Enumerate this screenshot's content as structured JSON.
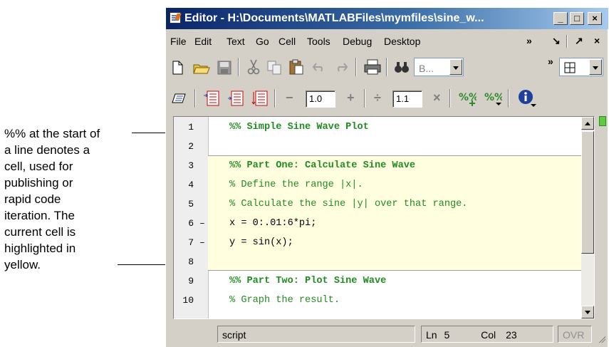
{
  "annotation": {
    "lines": [
      "%% at the start of",
      "a line denotes a",
      "cell, used for",
      "publishing or",
      "rapid code",
      "iteration. The",
      "current cell is",
      "highlighted in",
      "yellow."
    ]
  },
  "window": {
    "title": "Editor - H:\\Documents\\MATLABFiles\\mymfiles\\sine_w...",
    "controls": {
      "minimize": "_",
      "maximize": "□",
      "close": "×"
    }
  },
  "menubar": {
    "items": [
      "File",
      "Edit",
      "Text",
      "Go",
      "Cell",
      "Tools",
      "Debug",
      "Desktop"
    ],
    "overflow": "»",
    "dock": "↘",
    "undock": "↗",
    "close": "×"
  },
  "toolbar1": {
    "icons": [
      "new-file-icon",
      "open-folder-icon",
      "save-icon",
      "cut-icon",
      "copy-icon",
      "paste-icon",
      "undo-icon",
      "redo-icon",
      "print-icon",
      "find-icon"
    ],
    "stack_combo": "B...",
    "overflow": "»",
    "layout_icon": "tile-layout-icon"
  },
  "toolbar2": {
    "decrement": "−",
    "increment_value": "1.0",
    "increment": "+",
    "divide": "÷",
    "multiply_value": "1.1",
    "multiply": "×",
    "info": "info-icon"
  },
  "code": {
    "lines": [
      {
        "n": "1",
        "mark": "",
        "text": "%% Simple Sine Wave Plot",
        "style": "h"
      },
      {
        "n": "2",
        "mark": "",
        "text": "",
        "style": ""
      },
      {
        "n": "3",
        "mark": "",
        "text": "%% Part One: Calculate Sine Wave",
        "style": "h"
      },
      {
        "n": "4",
        "mark": "",
        "text": "% Define the range |x|.",
        "style": "c"
      },
      {
        "n": "5",
        "mark": "",
        "text": "% Calculate the sine |y| over that range.",
        "style": "c"
      },
      {
        "n": "6",
        "mark": "–",
        "text": "x = 0:.01:6*pi;",
        "style": ""
      },
      {
        "n": "7",
        "mark": "–",
        "text": "y = sin(x);",
        "style": ""
      },
      {
        "n": "8",
        "mark": "",
        "text": "",
        "style": ""
      },
      {
        "n": "9",
        "mark": "",
        "text": "%% Part Two: Plot Sine Wave",
        "style": "h"
      },
      {
        "n": "10",
        "mark": "",
        "text": "% Graph the result.",
        "style": "c"
      }
    ],
    "highlight_color": "#ffffe0",
    "comment_color": "#228b22"
  },
  "status": {
    "mode": "script",
    "line_label": "Ln",
    "line": "5",
    "col_label": "Col",
    "col": "23",
    "ovr": "OVR"
  }
}
